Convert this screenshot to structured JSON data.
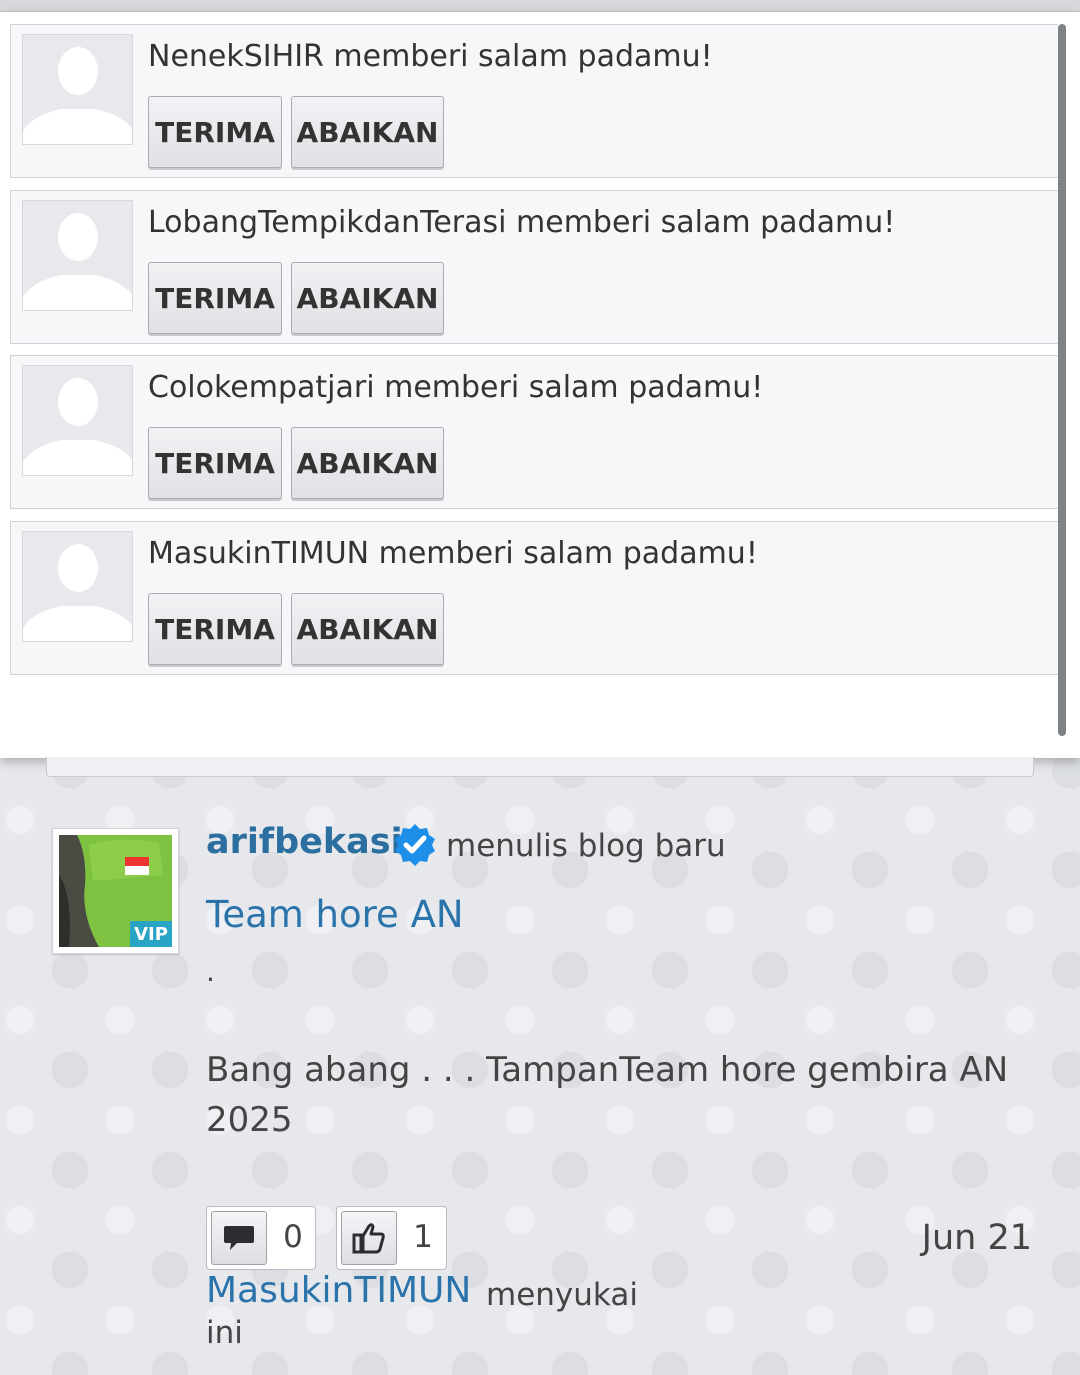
{
  "requests": [
    {
      "message": "NenekSIHIR memberi salam padamu!",
      "accept_label": "TERIMA",
      "ignore_label": "ABAIKAN"
    },
    {
      "message": "LobangTempikdanTerasi memberi salam padamu!",
      "accept_label": "TERIMA",
      "ignore_label": "ABAIKAN"
    },
    {
      "message": "Colokempatjari memberi salam padamu!",
      "accept_label": "TERIMA",
      "ignore_label": "ABAIKAN"
    },
    {
      "message": "MasukinTIMUN memberi salam padamu!",
      "accept_label": "TERIMA",
      "ignore_label": "ABAIKAN"
    }
  ],
  "feed": {
    "username": "arifbekasi",
    "action": "menulis blog baru",
    "badge": "VIP",
    "title": "Team hore AN",
    "dot": ".",
    "body": "Bang abang . . . TampanTeam hore gembira AN 2025",
    "comment_count": "0",
    "like_count": "1",
    "date": "Jun 21",
    "liker_name": "MasukinTIMUN",
    "liker_text_1": "menyukai",
    "liker_text_2": "ini"
  },
  "colors": {
    "link": "#2a73ab",
    "verified": "#1d8fe8",
    "vip": "#29a4c4"
  }
}
